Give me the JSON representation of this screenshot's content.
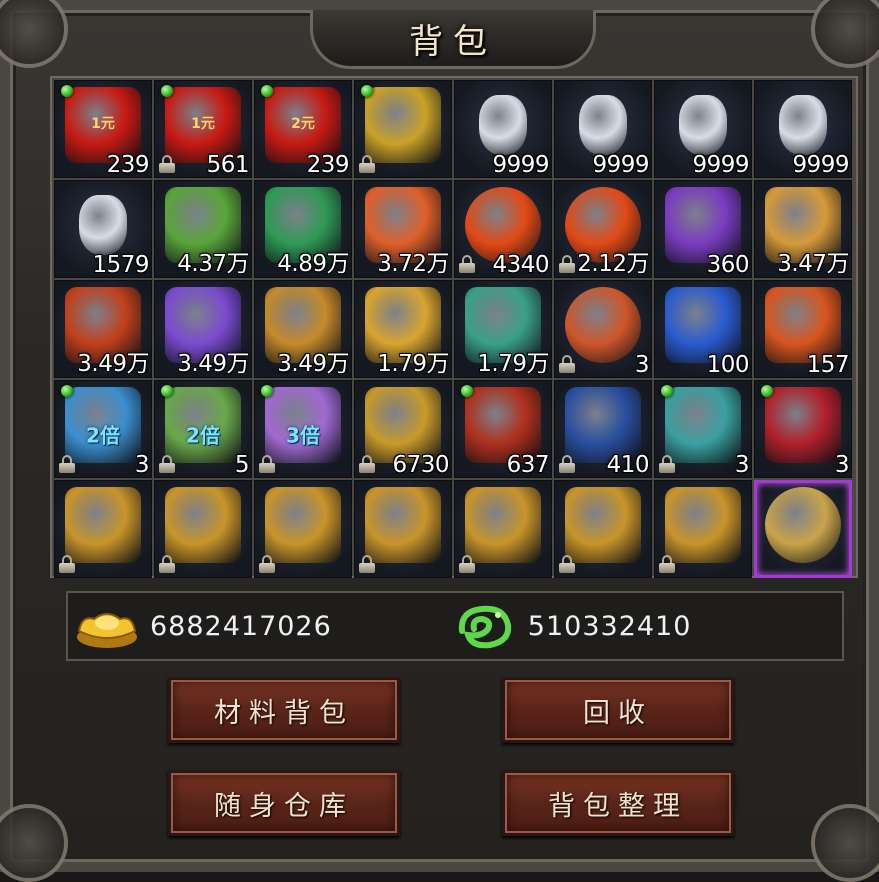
{
  "title": "背包",
  "slots": [
    {
      "icon": "red-envelope-1yuan-icon",
      "label": "1元",
      "count": "239",
      "gem": true,
      "lock": false,
      "bg": "#c81a12"
    },
    {
      "icon": "red-envelope-1yuan-icon",
      "label": "1元",
      "count": "561",
      "gem": true,
      "lock": true,
      "bg": "#c81a12"
    },
    {
      "icon": "red-envelope-2yuan-icon",
      "label": "2元",
      "count": "239",
      "gem": true,
      "lock": false,
      "bg": "#c81a12"
    },
    {
      "icon": "gold-book-icon",
      "label": "",
      "count": "",
      "gem": true,
      "lock": true,
      "bg": "#c9a227"
    },
    {
      "icon": "white-potion-bottle-icon",
      "label": "",
      "count": "9999",
      "gem": false,
      "lock": false,
      "bg": "#d7dde6"
    },
    {
      "icon": "white-potion-bottle-icon",
      "label": "",
      "count": "9999",
      "gem": false,
      "lock": false,
      "bg": "#d7dde6"
    },
    {
      "icon": "white-potion-bottle-icon",
      "label": "",
      "count": "9999",
      "gem": false,
      "lock": false,
      "bg": "#d7dde6"
    },
    {
      "icon": "white-potion-bottle-icon",
      "label": "",
      "count": "9999",
      "gem": false,
      "lock": false,
      "bg": "#d7dde6"
    },
    {
      "icon": "white-potion-bottle-icon",
      "label": "",
      "count": "1579",
      "gem": false,
      "lock": false,
      "bg": "#d7dde6"
    },
    {
      "icon": "green-feather-icon",
      "label": "",
      "count": "4.37万",
      "gem": false,
      "lock": false,
      "bg": "#5aa53a"
    },
    {
      "icon": "jade-dragon-icon",
      "label": "",
      "count": "4.89万",
      "gem": false,
      "lock": false,
      "bg": "#2f9a55"
    },
    {
      "icon": "flame-feather-icon",
      "label": "",
      "count": "3.72万",
      "gem": false,
      "lock": false,
      "bg": "#e0602a"
    },
    {
      "icon": "fire-orb-icon",
      "label": "",
      "count": "4340",
      "gem": false,
      "lock": true,
      "bg": "#e24a16"
    },
    {
      "icon": "fire-orb-icon",
      "label": "",
      "count": "2.12万",
      "gem": false,
      "lock": true,
      "bg": "#e24a16"
    },
    {
      "icon": "purple-scroll-icon",
      "label": "",
      "count": "360",
      "gem": false,
      "lock": false,
      "bg": "#7a3cc0"
    },
    {
      "icon": "golden-wings-icon",
      "label": "",
      "count": "3.47万",
      "gem": false,
      "lock": false,
      "bg": "#d79a3a"
    },
    {
      "icon": "dragon-scale-icon",
      "label": "",
      "count": "3.49万",
      "gem": false,
      "lock": false,
      "bg": "#c2401c"
    },
    {
      "icon": "purple-crystal-icon",
      "label": "",
      "count": "3.49万",
      "gem": false,
      "lock": false,
      "bg": "#7b4bd0"
    },
    {
      "icon": "golden-scroll-icon",
      "label": "",
      "count": "3.49万",
      "gem": false,
      "lock": false,
      "bg": "#c58a2a"
    },
    {
      "icon": "gold-flask-icon",
      "label": "",
      "count": "1.79万",
      "gem": false,
      "lock": false,
      "bg": "#d9a530"
    },
    {
      "icon": "jade-flask-icon",
      "label": "",
      "count": "1.79万",
      "gem": false,
      "lock": false,
      "bg": "#3aa08a"
    },
    {
      "icon": "red-crystal-ball-icon",
      "label": "",
      "count": "3",
      "gem": false,
      "lock": true,
      "bg": "#d0562a"
    },
    {
      "icon": "blue-flame-icon",
      "label": "",
      "count": "100",
      "gem": false,
      "lock": false,
      "bg": "#2a5cd0"
    },
    {
      "icon": "fire-shield-icon",
      "label": "",
      "count": "157",
      "gem": false,
      "lock": false,
      "bg": "#d8561e"
    },
    {
      "icon": "double-exp-card-icon",
      "label": "2倍",
      "count": "3",
      "gem": true,
      "lock": true,
      "bg": "#3c8fd0"
    },
    {
      "icon": "double-scroll-icon",
      "label": "2倍",
      "count": "5",
      "gem": true,
      "lock": true,
      "bg": "#6aa84a"
    },
    {
      "icon": "triple-scroll-icon",
      "label": "3倍",
      "count": "",
      "gem": true,
      "lock": true,
      "bg": "#a06ad0"
    },
    {
      "icon": "golden-chest-icon",
      "label": "",
      "count": "6730",
      "gem": false,
      "lock": true,
      "bg": "#c89a2a"
    },
    {
      "icon": "red-chest-icon",
      "label": "",
      "count": "637",
      "gem": true,
      "lock": false,
      "bg": "#b0301c"
    },
    {
      "icon": "blue-chest-icon",
      "label": "",
      "count": "410",
      "gem": false,
      "lock": true,
      "bg": "#2a4fa0"
    },
    {
      "icon": "jeweled-chest-icon",
      "label": "",
      "count": "3",
      "gem": true,
      "lock": true,
      "bg": "#3aa0a0"
    },
    {
      "icon": "yin-yang-chest-icon",
      "label": "",
      "count": "3",
      "gem": true,
      "lock": false,
      "bg": "#b0202a"
    },
    {
      "icon": "golden-ox-icon",
      "label": "",
      "count": "",
      "gem": false,
      "lock": true,
      "bg": "#c9952a"
    },
    {
      "icon": "golden-ox-icon",
      "label": "",
      "count": "",
      "gem": false,
      "lock": true,
      "bg": "#c9952a"
    },
    {
      "icon": "golden-lion-icon",
      "label": "",
      "count": "",
      "gem": false,
      "lock": true,
      "bg": "#c9952a"
    },
    {
      "icon": "golden-rabbit-icon",
      "label": "",
      "count": "",
      "gem": false,
      "lock": true,
      "bg": "#c9952a"
    },
    {
      "icon": "golden-dragon-icon",
      "label": "",
      "count": "",
      "gem": false,
      "lock": true,
      "bg": "#c9952a"
    },
    {
      "icon": "golden-snake-icon",
      "label": "",
      "count": "",
      "gem": false,
      "lock": true,
      "bg": "#c9952a"
    },
    {
      "icon": "golden-horse-icon",
      "label": "",
      "count": "",
      "gem": false,
      "lock": true,
      "bg": "#c9952a"
    },
    {
      "icon": "gold-coin-icon",
      "label": "",
      "count": "",
      "gem": false,
      "lock": false,
      "bg": "#c9a44a",
      "selected": true
    }
  ],
  "currency": {
    "gold_icon": "gold-ingot-icon",
    "gold_value": "6882417026",
    "jade_icon": "jade-dragon-coin-icon",
    "jade_value": "510332410"
  },
  "buttons": {
    "materials": "材料背包",
    "recycle": "回收",
    "storage": "随身仓库",
    "sort": "背包整理"
  },
  "colors": {
    "selected_border": "#a33ad6",
    "button_bg": "#5a2419",
    "gem": "#2fae22"
  }
}
